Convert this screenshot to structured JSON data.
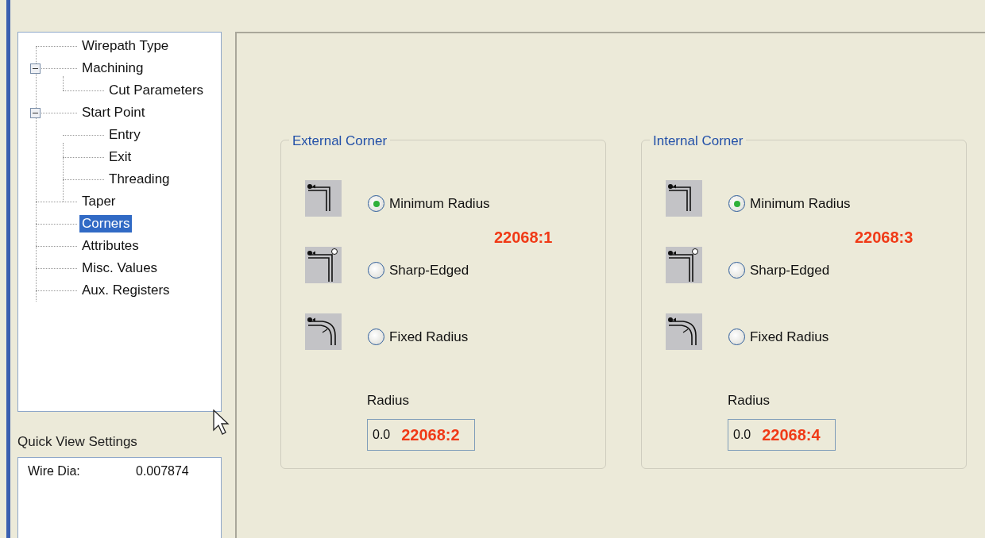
{
  "tree": [
    {
      "label": "Wirepath Type",
      "selected": false
    },
    {
      "label": "Machining",
      "expanded": true,
      "selected": false,
      "children": [
        {
          "label": "Cut Parameters",
          "selected": false
        }
      ]
    },
    {
      "label": "Start Point",
      "expanded": true,
      "selected": false,
      "children": [
        {
          "label": "Entry",
          "selected": false
        },
        {
          "label": "Exit",
          "selected": false
        },
        {
          "label": "Threading",
          "selected": false
        }
      ]
    },
    {
      "label": "Taper",
      "selected": false
    },
    {
      "label": "Corners",
      "selected": true
    },
    {
      "label": "Attributes",
      "selected": false
    },
    {
      "label": "Misc. Values",
      "selected": false
    },
    {
      "label": "Aux. Registers",
      "selected": false
    }
  ],
  "quick_view": {
    "title": "Quick View Settings",
    "rows": [
      {
        "label": "Wire Dia:",
        "value": "0.007874"
      }
    ]
  },
  "groups": [
    {
      "title": "External Corner",
      "options": [
        {
          "kind": "minimum",
          "label": "Minimum Radius",
          "selected": true
        },
        {
          "kind": "sharp",
          "label": "Sharp-Edged",
          "selected": false
        },
        {
          "kind": "fixed",
          "label": "Fixed Radius",
          "selected": false
        }
      ],
      "annotation": "22068:1",
      "radius_label": "Radius",
      "radius_value": "0.0",
      "radius_annotation": "22068:2"
    },
    {
      "title": "Internal Corner",
      "options": [
        {
          "kind": "minimum",
          "label": "Minimum Radius",
          "selected": true
        },
        {
          "kind": "sharp",
          "label": "Sharp-Edged",
          "selected": false
        },
        {
          "kind": "fixed",
          "label": "Fixed Radius",
          "selected": false
        }
      ],
      "annotation": "22068:3",
      "radius_label": "Radius",
      "radius_value": "0.0",
      "radius_annotation": "22068:4"
    }
  ]
}
